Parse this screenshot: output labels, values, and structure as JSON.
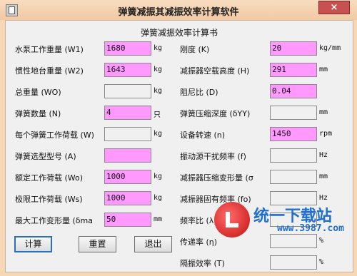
{
  "window": {
    "title": "弹簧减振其减振效率计算软件",
    "close_label": "×"
  },
  "section_title": "弹簧减振效率计算书",
  "left": [
    {
      "label": "水泵工作重量 (W1)",
      "value": "1680",
      "unit": "kg",
      "style": "pink"
    },
    {
      "label": "惯性地台重量 (W2)",
      "value": "1643",
      "unit": "kg",
      "style": "pink"
    },
    {
      "label": "总重量 (WO)",
      "value": "",
      "unit": "kg",
      "style": "gray"
    },
    {
      "label": "弹簧数量 (N)",
      "value": "4",
      "unit": "只",
      "style": "pink"
    },
    {
      "label": "每个弹簧工作荷载 (W)",
      "value": "",
      "unit": "kg",
      "style": "gray"
    },
    {
      "label": "弹簧选型型号 (A)",
      "value": "",
      "unit": "",
      "style": "pink"
    },
    {
      "label": "额定工作荷载 (Wo)",
      "value": "1000",
      "unit": "kg",
      "style": "pink"
    },
    {
      "label": "极限工作荷载 (Ws)",
      "value": "1000",
      "unit": "kg",
      "style": "pink"
    },
    {
      "label": "最大工作变形量 (δma",
      "value": "50",
      "unit": "mm",
      "style": "pink"
    }
  ],
  "right": [
    {
      "label": "刚度 (K)",
      "value": "20",
      "unit": "kg/mm",
      "style": "pink"
    },
    {
      "label": "减振器空载高度 (H)",
      "value": "291",
      "unit": "mm",
      "style": "pink"
    },
    {
      "label": "阻尼比 (D)",
      "value": "0.04",
      "unit": "",
      "style": "pink"
    },
    {
      "label": "弹簧压缩深度 (δYY)",
      "value": "",
      "unit": "mm",
      "style": "gray"
    },
    {
      "label": "设备转速 (n)",
      "value": "1450",
      "unit": "rpm",
      "style": "pink"
    },
    {
      "label": "振动源干扰频率 (f)",
      "value": "",
      "unit": "Hz",
      "style": "gray"
    },
    {
      "label": "减振器压缩变形量 (σ",
      "value": "",
      "unit": "mm",
      "style": "gray"
    },
    {
      "label": "减振器固有频率 (fo)",
      "value": "",
      "unit": "Hz",
      "style": "gray"
    },
    {
      "label": "频率比 (λ)",
      "value": "",
      "unit": "",
      "style": "gray"
    },
    {
      "label": "传递率 (η)",
      "value": "",
      "unit": "%",
      "style": "gray"
    },
    {
      "label": "隔振效率 (T)",
      "value": "",
      "unit": "%",
      "style": "gray"
    }
  ],
  "buttons": {
    "calc": "计算",
    "reset": "重置",
    "exit": "退出"
  },
  "watermark": {
    "text": "统一下载站",
    "url": "www.3987.com"
  }
}
